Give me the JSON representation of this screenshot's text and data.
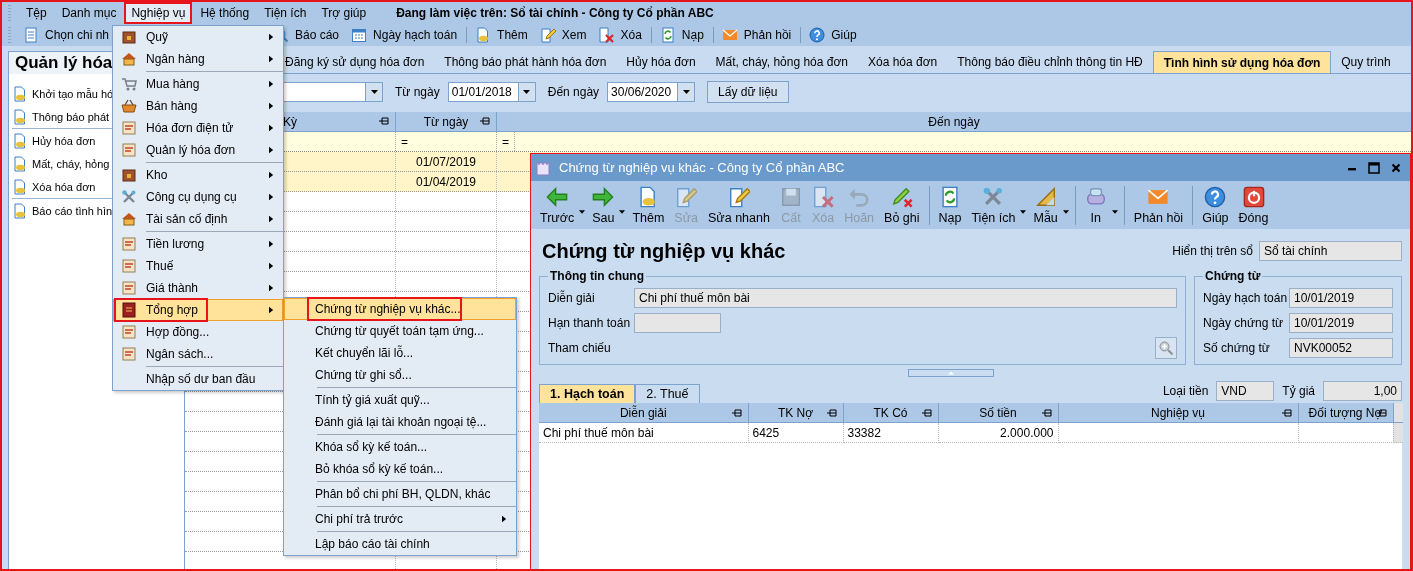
{
  "menu_bar": {
    "items": [
      {
        "label": "Tệp",
        "selected": false,
        "marked": false
      },
      {
        "label": "Danh mục",
        "selected": false,
        "marked": false
      },
      {
        "label": "Nghiệp vụ",
        "selected": true,
        "marked": true
      },
      {
        "label": "Hệ thống",
        "selected": false,
        "marked": false
      },
      {
        "label": "Tiện ích",
        "selected": false,
        "marked": false
      },
      {
        "label": "Trợ giúp",
        "selected": false,
        "marked": false
      }
    ],
    "status": "Đang làm việc trên: Sổ tài chính - Công ty Cổ phần ABC"
  },
  "toolbar": [
    {
      "label": "Chọn chi nh",
      "kind": "list",
      "separator_before": false
    },
    {
      "label": "Báo cáo",
      "kind": "report",
      "separator_before": false
    },
    {
      "label": "Ngày hạch toán",
      "kind": "calendar",
      "separator_before": false
    },
    {
      "label": "Thêm",
      "kind": "doc",
      "separator_before": true
    },
    {
      "label": "Xem",
      "kind": "edit",
      "separator_before": false
    },
    {
      "label": "Xóa",
      "kind": "delete",
      "separator_before": false
    },
    {
      "label": "Nạp",
      "kind": "refresh",
      "separator_before": true
    },
    {
      "label": "Phản hồi",
      "kind": "mail",
      "separator_before": true
    },
    {
      "label": "Giúp",
      "kind": "help",
      "separator_before": true
    }
  ],
  "sidebar": {
    "title": "Quản lý hóa",
    "groups": [
      {
        "items": [
          "Khởi tạo mẫu hó",
          "Thông báo phát"
        ]
      },
      {
        "items": [
          "Hủy hóa đơn",
          "Mất, cháy, hỏng",
          "Xóa hóa đơn"
        ]
      },
      {
        "items": [
          "Báo cáo tình hìn"
        ]
      }
    ]
  },
  "tabs": [
    {
      "label": "Đăng ký sử dụng hóa đơn",
      "selected": false
    },
    {
      "label": "Thông báo phát hành hóa đơn",
      "selected": false
    },
    {
      "label": "Hủy hóa đơn",
      "selected": false
    },
    {
      "label": "Mất, cháy, hỏng hóa đơn",
      "selected": false
    },
    {
      "label": "Xóa hóa đơn",
      "selected": false
    },
    {
      "label": "Thông báo điều chỉnh thông tin HĐ",
      "selected": false
    },
    {
      "label": "Tình hình sử dụng hóa đơn",
      "selected": true
    },
    {
      "label": "Quy trình",
      "selected": false
    }
  ],
  "filter": {
    "from_label": "Từ ngày",
    "from_value": "01/01/2018",
    "to_label": "Đến ngày",
    "to_value": "30/06/2020",
    "button": "Lấy dữ liệu"
  },
  "invoice_grid": {
    "columns": [
      {
        "label": "Kỳ",
        "pin": true
      },
      {
        "label": "Từ ngày",
        "pin": true
      },
      {
        "label": "Đến ngày",
        "pin": false
      }
    ],
    "filter_marks": [
      "=",
      "="
    ],
    "rows": [
      {
        "from_date": "01/07/2019"
      },
      {
        "from_date": "01/04/2019"
      }
    ]
  },
  "operations_menu": {
    "groups": [
      {
        "items": [
          {
            "label": "Quỹ",
            "kind": "box",
            "submenu": true,
            "selected": false,
            "marked": false
          },
          {
            "label": "Ngân hàng",
            "kind": "house",
            "submenu": true,
            "selected": false,
            "marked": false
          }
        ]
      },
      {
        "items": [
          {
            "label": "Mua hàng",
            "kind": "cart",
            "submenu": true,
            "selected": false,
            "marked": false
          },
          {
            "label": "Bán hàng",
            "kind": "basket",
            "submenu": true,
            "selected": false,
            "marked": false
          },
          {
            "label": "Hóa đơn điện tử",
            "kind": "paper",
            "submenu": true,
            "selected": false,
            "marked": false
          },
          {
            "label": "Quản lý hóa đơn",
            "kind": "paper",
            "submenu": true,
            "selected": false,
            "marked": false
          }
        ]
      },
      {
        "items": [
          {
            "label": "Kho",
            "kind": "box",
            "submenu": true,
            "selected": false,
            "marked": false
          },
          {
            "label": "Công cụ dụng cụ",
            "kind": "tools",
            "submenu": true,
            "selected": false,
            "marked": false
          },
          {
            "label": "Tài sản cố định",
            "kind": "house",
            "submenu": true,
            "selected": false,
            "marked": false
          }
        ]
      },
      {
        "items": [
          {
            "label": "Tiền lương",
            "kind": "paper",
            "submenu": true,
            "selected": false,
            "marked": false
          },
          {
            "label": "Thuế",
            "kind": "paper",
            "submenu": true,
            "selected": false,
            "marked": false
          },
          {
            "label": "Giá thành",
            "kind": "paper",
            "submenu": true,
            "selected": false,
            "marked": false
          },
          {
            "label": "Tổng hợp",
            "kind": "book",
            "submenu": true,
            "selected": true,
            "marked": true
          },
          {
            "label": "Hợp đồng...",
            "kind": "paper",
            "submenu": false,
            "selected": false,
            "marked": false
          },
          {
            "label": "Ngân sách...",
            "kind": "paper",
            "submenu": false,
            "selected": false,
            "marked": false
          }
        ]
      },
      {
        "items": [
          {
            "label": "Nhập số dư ban đầu",
            "submenu": false,
            "selected": false,
            "marked": false
          }
        ]
      }
    ]
  },
  "general_submenu": {
    "groups": [
      {
        "items": [
          {
            "label": "Chứng từ nghiệp vụ khác...",
            "submenu": false,
            "selected": true,
            "marked": true
          },
          {
            "label": "Chứng từ quyết toán tạm ứng...",
            "submenu": false,
            "selected": false,
            "marked": false
          },
          {
            "label": "Kết chuyển lãi lỗ...",
            "submenu": false,
            "selected": false,
            "marked": false
          },
          {
            "label": "Chứng từ ghi sổ...",
            "submenu": false,
            "selected": false,
            "marked": false
          }
        ]
      },
      {
        "items": [
          {
            "label": "Tính tỷ giá xuất quỹ...",
            "submenu": false,
            "selected": false,
            "marked": false
          },
          {
            "label": "Đánh giá lại tài khoản ngoại tệ...",
            "submenu": false,
            "selected": false,
            "marked": false
          }
        ]
      },
      {
        "items": [
          {
            "label": "Khóa sổ kỳ kế toán...",
            "submenu": false,
            "selected": false,
            "marked": false
          },
          {
            "label": "Bỏ khóa sổ kỳ kế toán...",
            "submenu": false,
            "selected": false,
            "marked": false
          }
        ]
      },
      {
        "items": [
          {
            "label": "Phân bổ chi phí BH, QLDN, khác",
            "submenu": false,
            "selected": false,
            "marked": false
          }
        ]
      },
      {
        "items": [
          {
            "label": "Chi phí trả trước",
            "submenu": true,
            "selected": false,
            "marked": false
          }
        ]
      },
      {
        "items": [
          {
            "label": "Lập báo cáo tài chính",
            "submenu": false,
            "selected": false,
            "marked": false
          }
        ]
      }
    ]
  },
  "dialog": {
    "title": "Chứng từ nghiệp vụ khác - Công ty Cổ phần ABC",
    "toolbar": [
      {
        "label": "Trước",
        "kind": "arrow-left",
        "disabled": false,
        "dropdown": true,
        "separator_before": false
      },
      {
        "label": "Sau",
        "kind": "arrow-right",
        "disabled": false,
        "dropdown": true,
        "separator_before": false
      },
      {
        "label": "Thêm",
        "kind": "doc",
        "disabled": false,
        "dropdown": false,
        "separator_before": false
      },
      {
        "label": "Sửa",
        "kind": "edit",
        "disabled": true,
        "dropdown": false,
        "separator_before": false
      },
      {
        "label": "Sửa nhanh",
        "kind": "edit",
        "disabled": false,
        "dropdown": false,
        "separator_before": false
      },
      {
        "label": "Cất",
        "kind": "save",
        "disabled": true,
        "dropdown": false,
        "separator_before": false
      },
      {
        "label": "Xóa",
        "kind": "delete",
        "disabled": true,
        "dropdown": false,
        "separator_before": false
      },
      {
        "label": "Hoãn",
        "kind": "undo",
        "disabled": true,
        "dropdown": false,
        "separator_before": false
      },
      {
        "label": "Bỏ ghi",
        "kind": "unpost",
        "disabled": false,
        "dropdown": false,
        "separator_before": false
      },
      {
        "label": "Nạp",
        "kind": "refresh",
        "disabled": false,
        "dropdown": false,
        "separator_before": true
      },
      {
        "label": "Tiện ích",
        "kind": "tools",
        "disabled": false,
        "dropdown": true,
        "separator_before": false
      },
      {
        "label": "Mẫu",
        "kind": "ruler",
        "disabled": false,
        "dropdown": true,
        "separator_before": false
      },
      {
        "label": "In",
        "kind": "printer",
        "disabled": false,
        "dropdown": true,
        "separator_before": true
      },
      {
        "label": "Phản hồi",
        "kind": "mail",
        "disabled": false,
        "dropdown": false,
        "separator_before": true
      },
      {
        "label": "Giúp",
        "kind": "help",
        "disabled": false,
        "dropdown": false,
        "separator_before": true
      },
      {
        "label": "Đóng",
        "kind": "power",
        "disabled": false,
        "dropdown": false,
        "separator_before": false
      }
    ],
    "heading": "Chứng từ nghiệp vụ khác",
    "book_label": "Hiển thị trên sổ",
    "book_value": "Sổ tài chính",
    "general": {
      "legend": "Thông tin chung",
      "description_label": "Diễn giải",
      "description_value": "Chi phí thuế môn bài",
      "due_label": "Hạn thanh toán",
      "reference_label": "Tham chiếu"
    },
    "voucher": {
      "legend": "Chứng từ",
      "fields": [
        {
          "label": "Ngày hạch toán",
          "value": "10/01/2019"
        },
        {
          "label": "Ngày chứng từ",
          "value": "10/01/2019"
        },
        {
          "label": "Số chứng từ",
          "value": "NVK00052"
        }
      ]
    },
    "currency_label": "Loại tiền",
    "currency_value": "VND",
    "rate_label": "Tỷ giá",
    "rate_value": "1,00",
    "tabs": [
      {
        "label": "1. Hạch toán",
        "selected": true
      },
      {
        "label": "2. Thuế",
        "selected": false
      }
    ],
    "grid": {
      "columns": [
        "Diễn giải",
        "TK Nợ",
        "TK Có",
        "Số tiền",
        "Nghiệp vụ",
        "Đối tượng Nợ"
      ],
      "rows": [
        {
          "cells": [
            "Chi phí thuế môn bài",
            "6425",
            "33382",
            "2.000.000"
          ]
        }
      ]
    }
  }
}
